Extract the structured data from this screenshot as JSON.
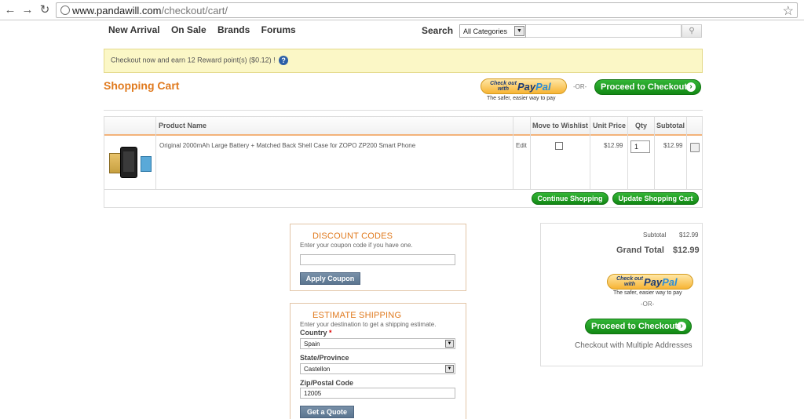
{
  "browser": {
    "url_domain": "www.pandawill.com",
    "url_path": "/checkout/cart/"
  },
  "topnav": {
    "items": [
      "New Arrival",
      "On Sale",
      "Brands",
      "Forums"
    ],
    "search_label": "Search",
    "category_selected": "All Categories"
  },
  "reward": {
    "text": "Checkout now and earn 12 Reward point(s) ($0.12) !",
    "help_icon": "?"
  },
  "page_title": "Shopping Cart",
  "paypal": {
    "checkout_with": "Check out with",
    "brand_pay": "Pay",
    "brand_pal": "Pal",
    "tagline": "The safer, easier way to pay",
    "or": "-OR-"
  },
  "checkout_button": "Proceed to Checkout",
  "cart": {
    "headers": {
      "product": "Product Name",
      "wishlist": "Move to Wishlist",
      "unit_price": "Unit Price",
      "qty": "Qty",
      "subtotal": "Subtotal"
    },
    "item": {
      "name": "Original 2000mAh Large Battery + Matched Back Shell Case for ZOPO ZP200 Smart Phone",
      "edit": "Edit",
      "unit_price": "$12.99",
      "qty": "1",
      "subtotal": "$12.99"
    },
    "continue_shopping": "Continue Shopping",
    "update_cart": "Update Shopping Cart"
  },
  "discount": {
    "title": "DISCOUNT CODES",
    "subtitle": "Enter your coupon code if you have one.",
    "button": "Apply Coupon"
  },
  "shipping": {
    "title": "ESTIMATE SHIPPING",
    "subtitle": "Enter your destination to get a shipping estimate.",
    "country_label": "Country",
    "country_value": "Spain",
    "state_label": "State/Province",
    "state_value": "Castellon",
    "zip_label": "Zip/Postal Code",
    "zip_value": "12005",
    "button": "Get a Quote"
  },
  "totals": {
    "subtotal_label": "Subtotal",
    "subtotal_value": "$12.99",
    "grand_label": "Grand Total",
    "grand_value": "$12.99",
    "multi_address": "Checkout with Multiple Addresses"
  }
}
